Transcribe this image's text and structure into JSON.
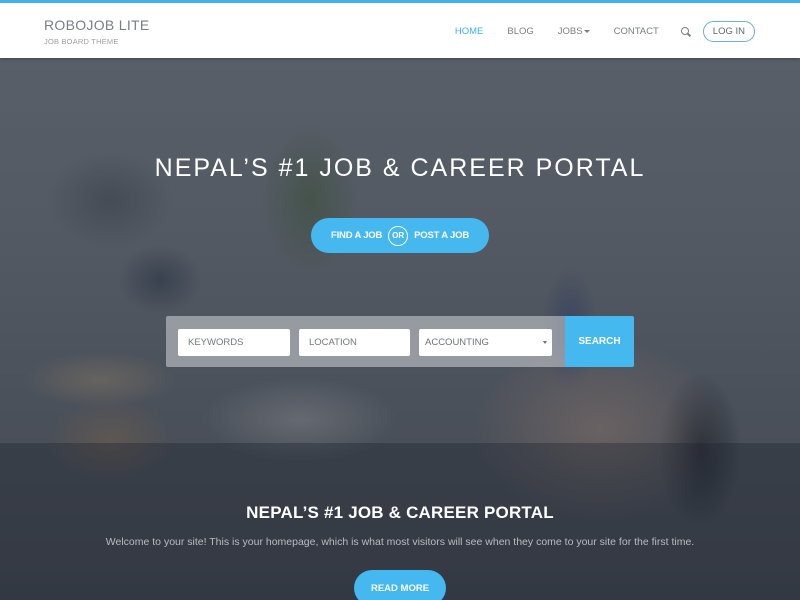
{
  "header": {
    "brand_title": "ROBOJOB LITE",
    "brand_subtitle": "JOB BOARD THEME",
    "accent_color": "#3fb3e6",
    "nav": [
      {
        "label": "HOME",
        "active": true
      },
      {
        "label": "BLOG",
        "active": false
      },
      {
        "label": "JOBS",
        "active": false,
        "has_dropdown": true
      },
      {
        "label": "CONTACT",
        "active": false
      }
    ],
    "search_icon": "search-icon",
    "login_label": "LOG IN"
  },
  "hero": {
    "title": "NEPAL’S #1 JOB & CAREER PORTAL",
    "find_job_label": "FIND A JOB",
    "or_label": "OR",
    "post_job_label": "POST A JOB",
    "button_color": "#45b8ef"
  },
  "search": {
    "keywords_placeholder": "KEYWORDS",
    "location_placeholder": "LOCATION",
    "category_selected": "ACCOUNTING",
    "search_label": "SEARCH"
  },
  "section": {
    "title": "NEPAL’S #1 JOB & CAREER PORTAL",
    "text": "Welcome to your site! This is your homepage, which is what most visitors will see when they come to your site for the first time.",
    "read_more_label": "READ MORE"
  }
}
